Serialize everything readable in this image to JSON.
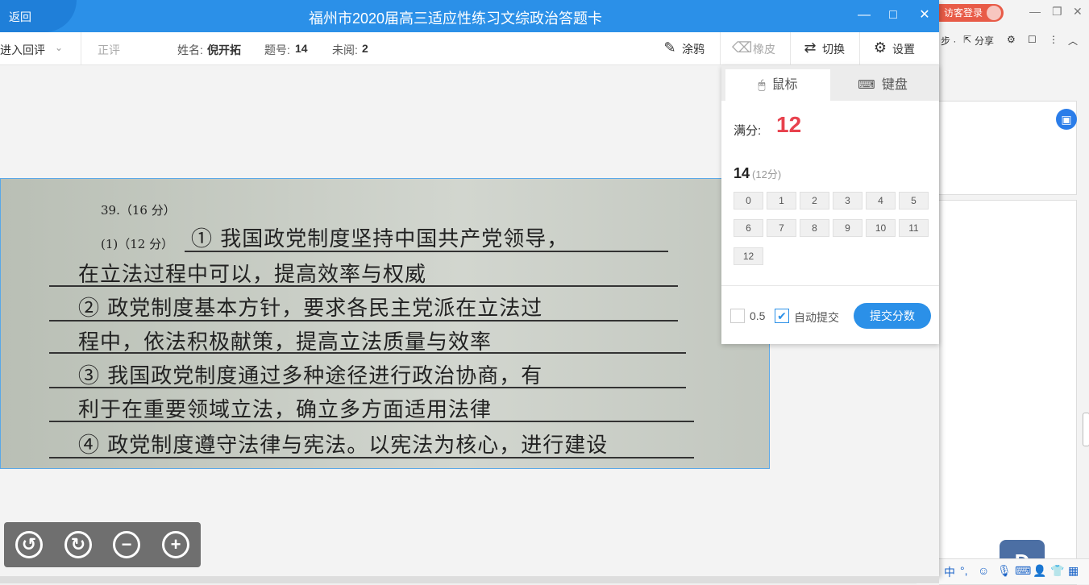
{
  "window": {
    "back_label": "返回",
    "title": "福州市2020届高三适应性练习文综政治答题卡",
    "minimize_glyph": "—",
    "maximize_glyph": "□",
    "close_glyph": "✕"
  },
  "toolbar": {
    "mode_label": "进入回评",
    "mode_chevron": "⌄",
    "rescore_label": "正评",
    "name_label": "姓名: ",
    "name_value": "倪开拓",
    "question_label": "题号: ",
    "question_value": "14",
    "unread_label": "未阅: ",
    "unread_value": "2",
    "tools": [
      {
        "label": "涂鸦",
        "icon": "pen-icon",
        "glyph": "✎"
      },
      {
        "label": "橡皮",
        "icon": "eraser-icon",
        "glyph": "⌫"
      },
      {
        "label": "切换",
        "icon": "switch-icon",
        "glyph": "⇄"
      },
      {
        "label": "设置",
        "icon": "gear-icon",
        "glyph": "⚙"
      }
    ]
  },
  "answer_sheet": {
    "question_header": "39.（16 分）",
    "part_header": "(1)（12 分）",
    "handwriting_lines": [
      "① 我国政党制度坚持中国共产党领导，",
      "在立法过程中可以，提高效率与权威",
      "② 政党制度基本方针，要求各民主党派在立法过",
      "程中，依法积极献策，提高立法质量与效率",
      "③ 我国政党制度通过多种途径进行政治协商，有",
      "利于在重要领域立法，确立多方面适用法律",
      "④ 政党制度遵守法律与宪法。以宪法为核心，进行建设"
    ]
  },
  "zoom_controls": {
    "rotate_left": "↺",
    "rotate_right": "↻",
    "zoom_out": "−",
    "zoom_in": "+"
  },
  "score_panel": {
    "tabs": [
      {
        "label": "鼠标",
        "icon": "mouse-icon",
        "glyph": "🖱"
      },
      {
        "label": "键盘",
        "icon": "keyboard-icon",
        "glyph": "⌨"
      }
    ],
    "full_label": "满分:",
    "full_value": "12",
    "question_number": "14",
    "question_points": "(12分)",
    "scores": [
      "0",
      "1",
      "2",
      "3",
      "4",
      "5",
      "6",
      "7",
      "8",
      "9",
      "10",
      "11",
      "12"
    ],
    "half_point_label": "0.5",
    "half_point_checked": false,
    "auto_submit_label": "自动提交",
    "auto_submit_checked": true,
    "submit_label": "提交分数",
    "accent_color": "#2b90e8",
    "full_score_color": "#e8414d"
  },
  "background_app": {
    "visitor_login": "访客登录",
    "toolbar_items": [
      "步 ·",
      "分享"
    ],
    "ime_text": "中",
    "logo_text": "D"
  }
}
